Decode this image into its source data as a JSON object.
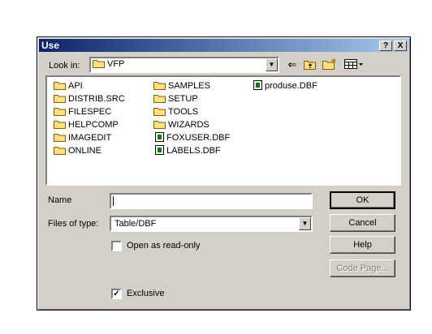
{
  "dialog": {
    "title": "Use",
    "help_button": "?",
    "close_button": "X"
  },
  "lookin": {
    "label": "Look in:",
    "value": "VFP"
  },
  "files": {
    "col1": [
      "API",
      "DISTRIB.SRC",
      "FILESPEC",
      "HELPCOMP",
      "IMAGEDIT",
      "ONLINE"
    ],
    "col2_folders": [
      "SAMPLES",
      "SETUP",
      "TOOLS",
      "WIZARDS"
    ],
    "col2_files": [
      "FOXUSER.DBF",
      "LABELS.DBF"
    ],
    "col3_files": [
      "produse.DBF"
    ]
  },
  "name": {
    "label": "Name",
    "value": ""
  },
  "filetype": {
    "label": "Files of type:",
    "value": "Table/DBF"
  },
  "buttons": {
    "ok": "OK",
    "cancel": "Cancel",
    "help": "Help",
    "code_page": "Code Page..."
  },
  "options": {
    "open_readonly_label": "Open as read-only",
    "open_readonly_checked": false,
    "exclusive_label": "Exclusive",
    "exclusive_checked": true
  }
}
